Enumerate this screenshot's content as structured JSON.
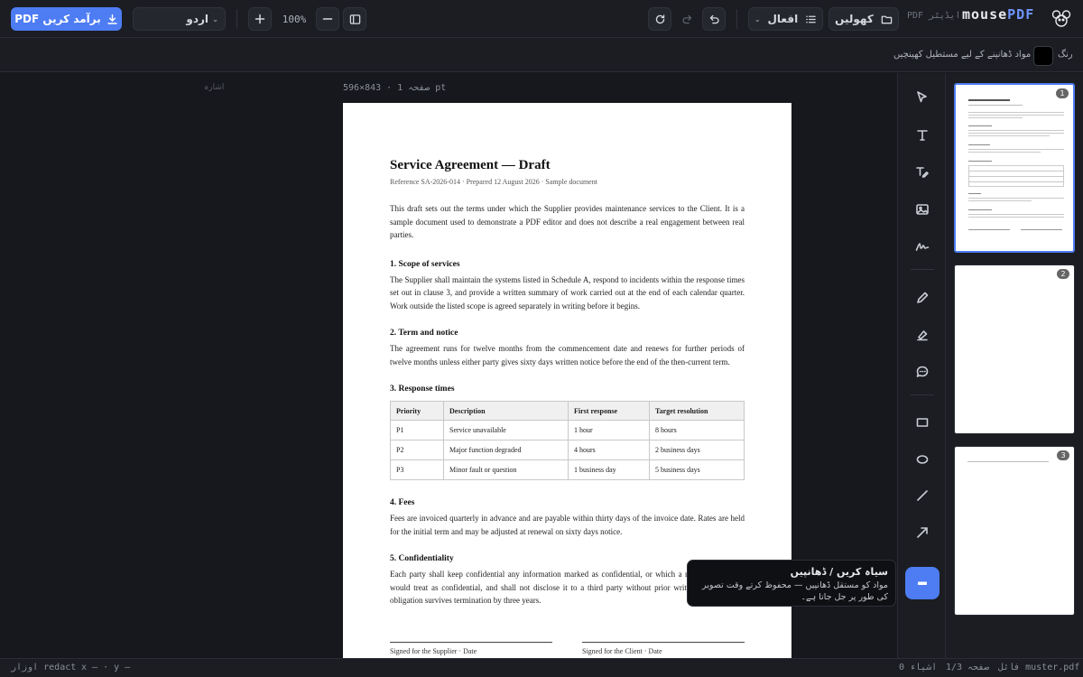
{
  "topbar": {
    "export_label": "PDF برآمد کریں",
    "language": "اردو",
    "zoom": "100%",
    "open_label": "کھولیں",
    "actions_label": "افعال",
    "logo_sub": "PDF ایڈیٹر",
    "logo_main": "mouse",
    "logo_accent": "PDF"
  },
  "subbar": {
    "color_label": "رنگ",
    "redact_hint": "مواد ڈھانپنے کے لیے مستطیل کھینچیں",
    "swatch_color": "#000000"
  },
  "workspace": {
    "hint": "اشارہ",
    "page_meta": "صفحہ 1 · 843×596 pt"
  },
  "document": {
    "title": "Service Agreement — Draft",
    "reference": "Reference SA-2026-014 · Prepared 12 August 2026 · Sample document",
    "intro": "This draft sets out the terms under which the Supplier provides maintenance services to the Client. It is a sample document used to demonstrate a PDF editor and does not describe a real engagement between real parties.",
    "s1_title": "1. Scope of services",
    "s1_body": "The Supplier shall maintain the systems listed in Schedule A, respond to incidents within the response times set out in clause 3, and provide a written summary of work carried out at the end of each calendar quarter. Work outside the listed scope is agreed separately in writing before it begins.",
    "s2_title": "2. Term and notice",
    "s2_body": "The agreement runs for twelve months from the commencement date and renews for further periods of twelve months unless either party gives sixty days written notice before the end of the then-current term.",
    "s3_title": "3. Response times",
    "table": {
      "headers": [
        "Priority",
        "Description",
        "First response",
        "Target resolution"
      ],
      "rows": [
        [
          "P1",
          "Service unavailable",
          "1 hour",
          "8 hours"
        ],
        [
          "P2",
          "Major function degraded",
          "4 hours",
          "2 business days"
        ],
        [
          "P3",
          "Minor fault or question",
          "1 business day",
          "5 business days"
        ]
      ]
    },
    "s4_title": "4. Fees",
    "s4_body": "Fees are invoiced quarterly in advance and are payable within thirty days of the invoice date. Rates are held for the initial term and may be adjusted at renewal on sixty days notice.",
    "s5_title": "5. Confidentiality",
    "s5_body": "Each party shall keep confidential any information marked as confidential, or which a reasonable person would treat as confidential, and shall not disclose it to a third party without prior written consent. This obligation survives termination by three years.",
    "sig_supplier": "Signed for the Supplier · Date",
    "sig_client": "Signed for the Client · Date"
  },
  "thumbnails": [
    "1",
    "2",
    "3"
  ],
  "tooltip": {
    "title": "سیاہ کریں / ڈھانپیں",
    "body": "مواد کو مستقل ڈھانپیں — محفوظ کرتے وقت تصویر کی طور پر جل جاتا ہے۔"
  },
  "status": {
    "tool": "اوزار  redact",
    "coords": "x — · y —",
    "file": "فائل  muster.pdf",
    "page": "صفحہ  1/3",
    "objects": "اشیاء  0"
  },
  "tools": [
    "select-icon",
    "text-icon",
    "edit-text-icon",
    "image-icon",
    "signature-icon",
    "pen-icon",
    "highlighter-icon",
    "comment-icon",
    "rectangle-icon",
    "ellipse-icon",
    "line-icon",
    "arrow-icon",
    "redact-icon"
  ]
}
